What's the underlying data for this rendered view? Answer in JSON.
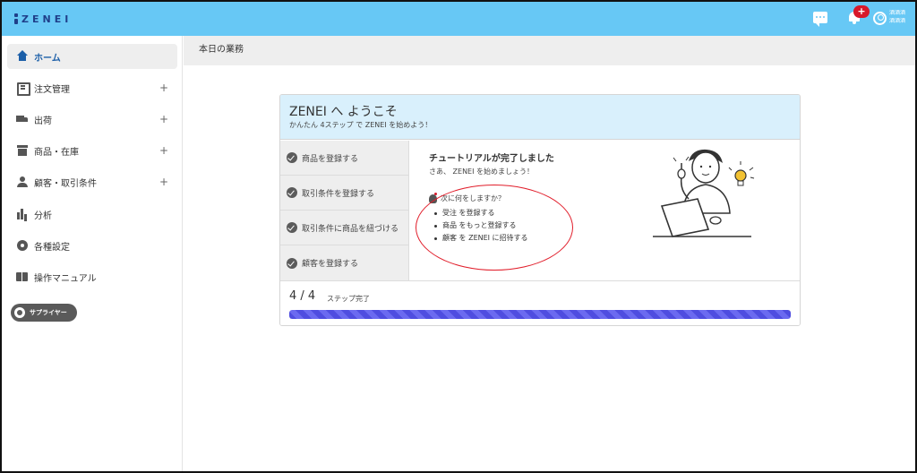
{
  "header": {
    "logo_text": "ZENEI",
    "notification_count": "+",
    "user_line1": "酒酒酒",
    "user_line2": "酒酒酒"
  },
  "breadcrumb": {
    "title": "本日の業務"
  },
  "sidebar": {
    "items": [
      {
        "label": "ホーム",
        "icon": "home-icon",
        "expandable": false,
        "active": true
      },
      {
        "label": "注文管理",
        "icon": "document-icon",
        "expandable": true
      },
      {
        "label": "出荷",
        "icon": "truck-icon",
        "expandable": true
      },
      {
        "label": "商品・在庫",
        "icon": "box-icon",
        "expandable": true
      },
      {
        "label": "顧客・取引条件",
        "icon": "person-icon",
        "expandable": true
      },
      {
        "label": "分析",
        "icon": "bar-chart-icon",
        "expandable": false
      },
      {
        "label": "各種設定",
        "icon": "gear-icon",
        "expandable": false
      },
      {
        "label": "操作マニュアル",
        "icon": "book-icon",
        "expandable": false
      }
    ],
    "plus_symbol": "+",
    "role_pill": "サプライヤー"
  },
  "welcome": {
    "title": "ZENEI へ ようこそ",
    "subtitle": "かんたん 4ステップ で ZENEI を始めよう！",
    "steps": [
      "商品を登録する",
      "取引条件を登録する",
      "取引条件に商品を紐づける",
      "顧客を登録する"
    ],
    "complete_title": "チュートリアルが完了しました",
    "complete_sub": "さあ、 ZENEI を始めましょう！",
    "next_question": "次に何をしますか？",
    "next_items": [
      "受注 を登録する",
      "商品 をもっと登録する",
      "顧客 を ZENEI に招待する"
    ],
    "progress_count": "4 / 4",
    "progress_label": "ステップ完了",
    "progress_fraction": 1.0
  },
  "colors": {
    "topbar": "#67c8f5",
    "accent": "#1c5fa8",
    "progress": "#4f4de0",
    "annotation": "#e11d2a"
  }
}
